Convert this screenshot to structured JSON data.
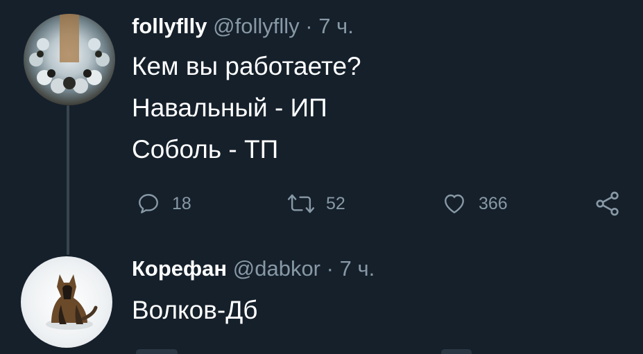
{
  "tweet1": {
    "display_name": "follyflly",
    "handle": "@follyflly",
    "separator": "·",
    "time": "7 ч.",
    "lines": [
      "Кем вы работаете?",
      "Навальный - ИП",
      "Соболь - ТП"
    ],
    "actions": {
      "reply": {
        "icon": "reply-icon",
        "count": "18"
      },
      "retweet": {
        "icon": "retweet-icon",
        "count": "52"
      },
      "like": {
        "icon": "heart-icon",
        "count": "366"
      },
      "share": {
        "icon": "share-icon"
      }
    }
  },
  "tweet2": {
    "display_name": "Корефан",
    "handle": "@dabkor",
    "separator": "·",
    "time": "7 ч.",
    "text": "Волков-Дб"
  },
  "colors": {
    "background": "#15202b",
    "text_primary": "#ffffff",
    "text_secondary": "#8899a6",
    "thread_line": "#38444d"
  }
}
